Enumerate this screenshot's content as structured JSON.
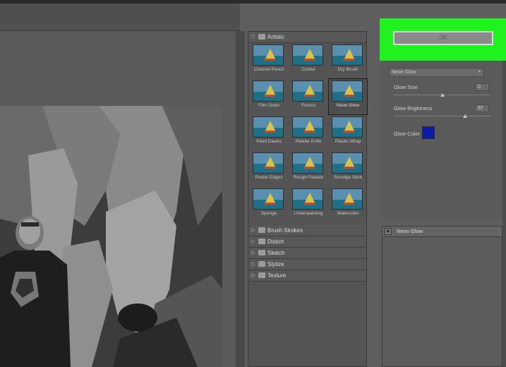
{
  "filter_gallery": {
    "artistic_category": "Artistic",
    "artistic_filters": [
      "Colored Pencil",
      "Cutout",
      "Dry Brush",
      "Film Grain",
      "Fresco",
      "Neon Glow",
      "Paint Daubs",
      "Palette Knife",
      "Plastic Wrap",
      "Poster Edges",
      "Rough Pastels",
      "Smudge Stick",
      "Sponge",
      "Underpainting",
      "Watercolor"
    ],
    "selected_filter": "Neon Glow",
    "other_categories": [
      "Brush Strokes",
      "Distort",
      "Sketch",
      "Stylize",
      "Texture"
    ]
  },
  "ok_button": {
    "label": "OK",
    "highlight_color": "#1ff21f"
  },
  "settings": {
    "filter_dropdown_value": "Neon Glow",
    "glow_size": {
      "label": "Glow Size",
      "value": "0"
    },
    "glow_brightness": {
      "label": "Glow Brightness",
      "value": "37"
    },
    "glow_color": {
      "label": "Glow Color",
      "color": "#0a1ca8"
    }
  },
  "effect_layers": {
    "items": [
      "Neon Glow"
    ]
  },
  "icons": {
    "expand": "triangle-right-icon",
    "collapse": "triangle-down-icon",
    "folder": "folder-icon",
    "visibility": "eye-icon"
  }
}
